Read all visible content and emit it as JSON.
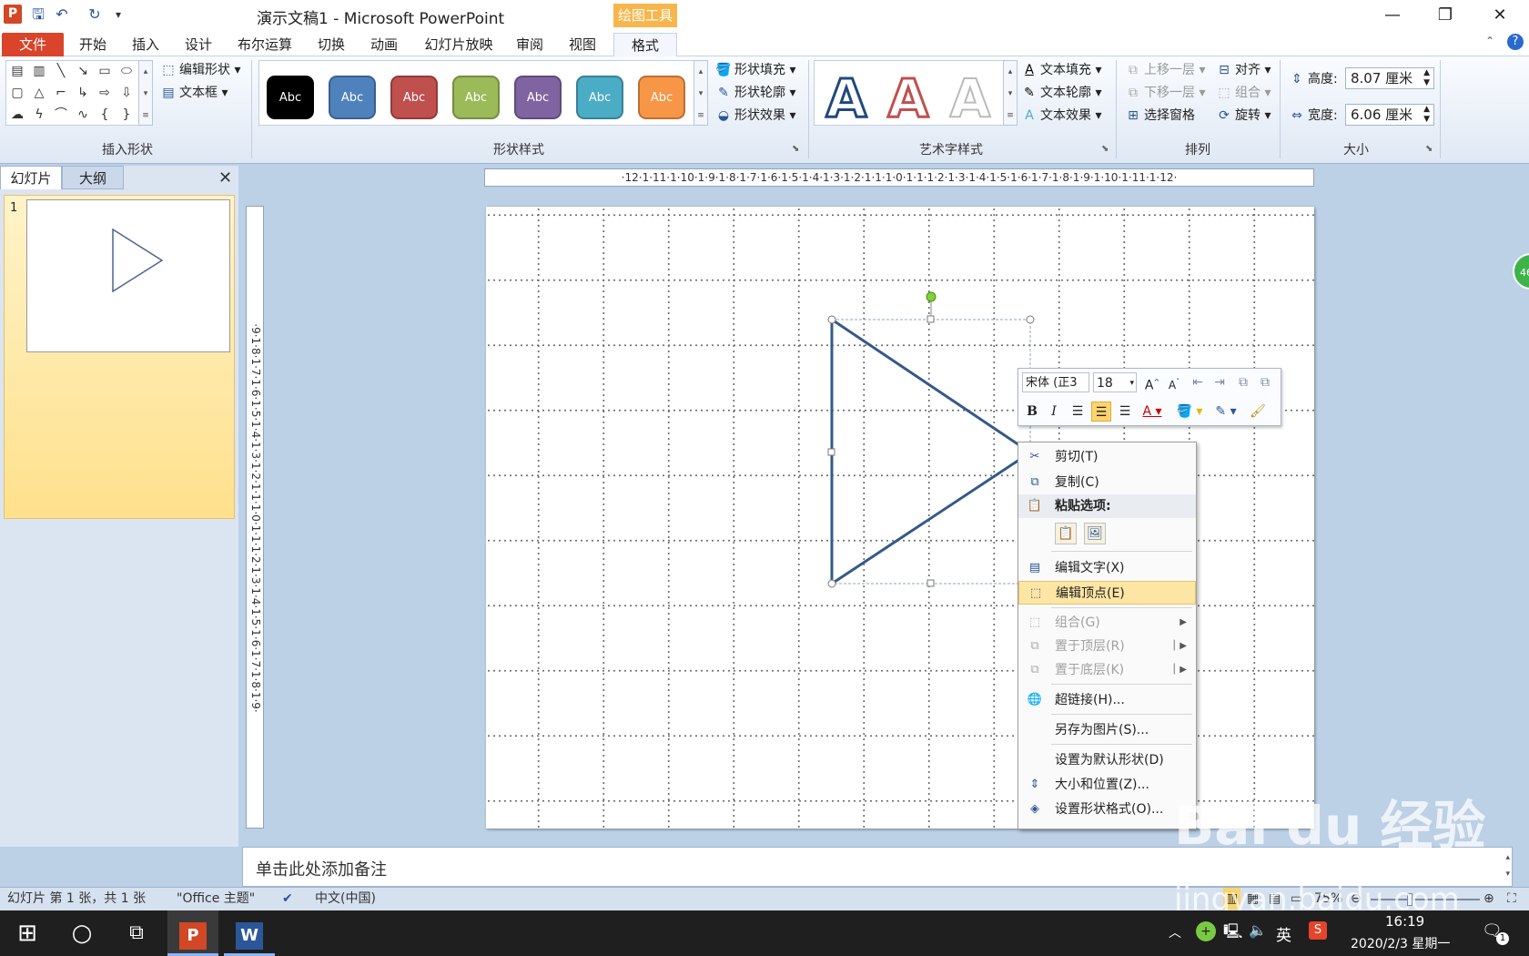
{
  "title_bar": {
    "app_letter": "P",
    "quick_icons": [
      "save-icon",
      "undo-icon",
      "redo-icon",
      "customize-icon"
    ],
    "title": "演示文稿1 - Microsoft PowerPoint",
    "contextual_tab_group": "绘图工具",
    "window_buttons": {
      "minimize": "—",
      "restore": "❐",
      "close": "✕"
    }
  },
  "tabs": {
    "file": "文件",
    "items": [
      "开始",
      "插入",
      "设计",
      "布尔运算",
      "切换",
      "动画",
      "幻灯片放映",
      "审阅",
      "视图"
    ],
    "active": "格式"
  },
  "ribbon": {
    "insert_shapes": {
      "label": "插入形状",
      "edit_shape": "编辑形状",
      "textbox": "文本框"
    },
    "shape_styles": {
      "label": "形状样式",
      "gallery": [
        {
          "text": "Abc",
          "color": "#000000"
        },
        {
          "text": "Abc",
          "color": "#4f81bd"
        },
        {
          "text": "Abc",
          "color": "#c0504d"
        },
        {
          "text": "Abc",
          "color": "#9bbb59"
        },
        {
          "text": "Abc",
          "color": "#8064a2"
        },
        {
          "text": "Abc",
          "color": "#4bacc6"
        },
        {
          "text": "Abc",
          "color": "#f79646"
        }
      ],
      "fill": "形状填充",
      "outline": "形状轮廓",
      "effects": "形状效果"
    },
    "wordart_styles": {
      "label": "艺术字样式",
      "gallery": [
        "A",
        "A",
        "A"
      ],
      "text_fill": "文本填充",
      "text_outline": "文本轮廓",
      "text_effects": "文本效果"
    },
    "arrange": {
      "label": "排列",
      "bring_forward": "上移一层",
      "send_backward": "下移一层",
      "selection_pane": "选择窗格",
      "align": "对齐",
      "group": "组合",
      "rotate": "旋转"
    },
    "size": {
      "label": "大小",
      "height_label": "高度:",
      "height_value": "8.07 厘米",
      "width_label": "宽度:",
      "width_value": "6.06 厘米"
    }
  },
  "left_panel": {
    "tab_slides": "幻灯片",
    "tab_outline": "大纲",
    "slide_number": "1"
  },
  "rulers": {
    "horizontal": "·12·1·11·1·10·1·9·1·8·1·7·1·6·1·5·1·4·1·3·1·2·1·1·1·0·1·1·1·2·1·3·1·4·1·5·1·6·1·7·1·8·1·9·1·10·1·11·1·12·",
    "vertical": "·9·1·8·1·7·1·6·1·5·1·4·1·3·1·2·1·1·1·0·1·1·1·2·1·3·1·4·1·5·1·6·1·7·1·8·1·9·"
  },
  "mini_toolbar": {
    "font": "宋体 (正3",
    "size": "18",
    "bold": "B",
    "italic": "I"
  },
  "context_menu": {
    "cut": "剪切(T)",
    "copy": "复制(C)",
    "paste_options": "粘贴选项:",
    "edit_text": "编辑文字(X)",
    "edit_points": "编辑顶点(E)",
    "group": "组合(G)",
    "bring_to_front": "置于顶层(R)",
    "send_to_back": "置于底层(K)",
    "hyperlink": "超链接(H)...",
    "save_as_picture": "另存为图片(S)...",
    "set_default_shape": "设置为默认形状(D)",
    "size_position": "大小和位置(Z)...",
    "format_shape": "设置形状格式(O)..."
  },
  "notes_placeholder": "单击此处添加备注",
  "status_bar": {
    "slide_info": "幻灯片 第 1 张，共 1 张",
    "theme": "\"Office 主题\"",
    "language": "中文(中国)",
    "zoom": "75%"
  },
  "taskbar": {
    "ime": "英",
    "time": "16:19",
    "date": "2020/2/3 星期一",
    "notification_count": "1"
  },
  "side_badge": "46",
  "watermark": {
    "main": "Bai du 经验",
    "url": "jingyan.baidu.com"
  }
}
